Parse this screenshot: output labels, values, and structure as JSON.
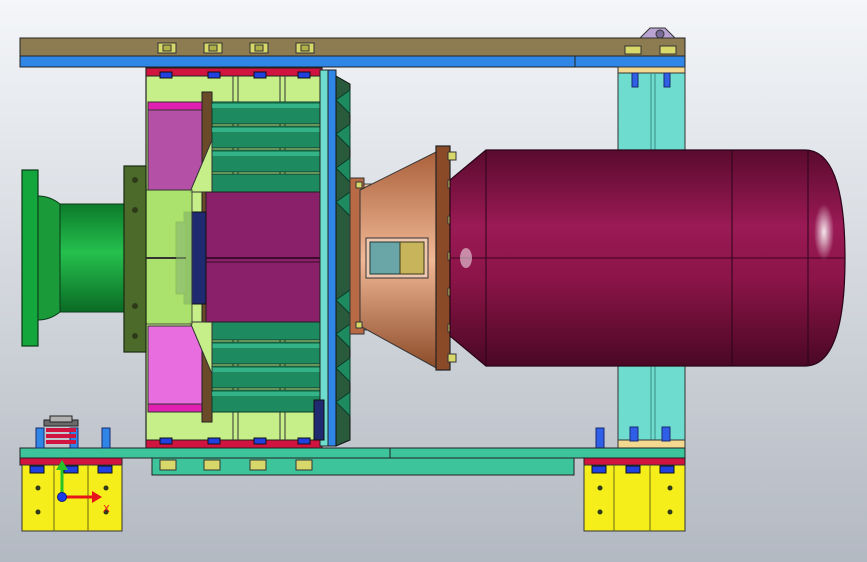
{
  "viewport": {
    "background_top": "#f4f6f9",
    "background_bottom": "#b3b9c2"
  },
  "triad": {
    "axes": [
      {
        "label": "",
        "color": "#27c22a"
      },
      {
        "label": "X",
        "color": "#e8141b"
      },
      {
        "label": "",
        "color": "#1b3be8"
      }
    ]
  },
  "colors": {
    "frame_brown": "#8d7b52",
    "frame_blue": "#2f86e6",
    "frame_teal": "#3ec49a",
    "pale_cyan": "#6fdcd0",
    "green_shaft": "#12a63d",
    "green_dark": "#1a6b2a",
    "olive": "#4c6b2a",
    "light_green": "#c6ef8a",
    "magenta": "#e86ee0",
    "pink_bar": "#e020b0",
    "purple": "#8a1f6a",
    "purple_light": "#b450a5",
    "teal_blade": "#1e8a60",
    "maroon_tank": "#8b1448",
    "copper": "#d59068",
    "yellow": "#f5ee1a",
    "bolt_yellow": "#d8d86a",
    "bolt_blue": "#2040e0",
    "crimson": "#d11340",
    "navy": "#1f2a70"
  }
}
